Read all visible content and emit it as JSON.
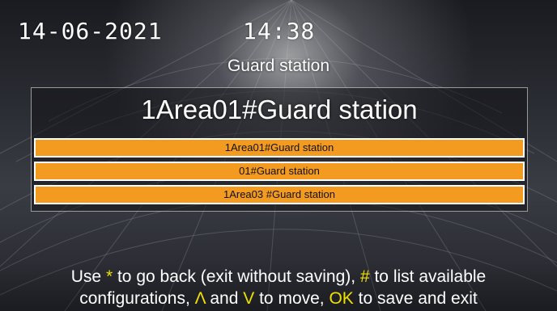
{
  "status_bar": {
    "date": "14-06-2021",
    "time": "14:38"
  },
  "page": {
    "title": "Guard station"
  },
  "selection": {
    "current_value": "1Area01#Guard station",
    "options": [
      "1Area01#Guard station",
      "01#Guard station",
      "1Area03 #Guard station"
    ]
  },
  "help": {
    "part1": "Use ",
    "key_star": "*",
    "part2": " to go back (exit without saving), ",
    "key_hash": "#",
    "part3": " to list available",
    "part4": "configurations, ",
    "key_up": "Λ",
    "part5": " and ",
    "key_down": "V",
    "part6": " to move, ",
    "key_ok": "OK",
    "part7": " to save and exit"
  },
  "colors": {
    "option_bg": "#f39a20",
    "key_highlight": "#f0e000"
  }
}
